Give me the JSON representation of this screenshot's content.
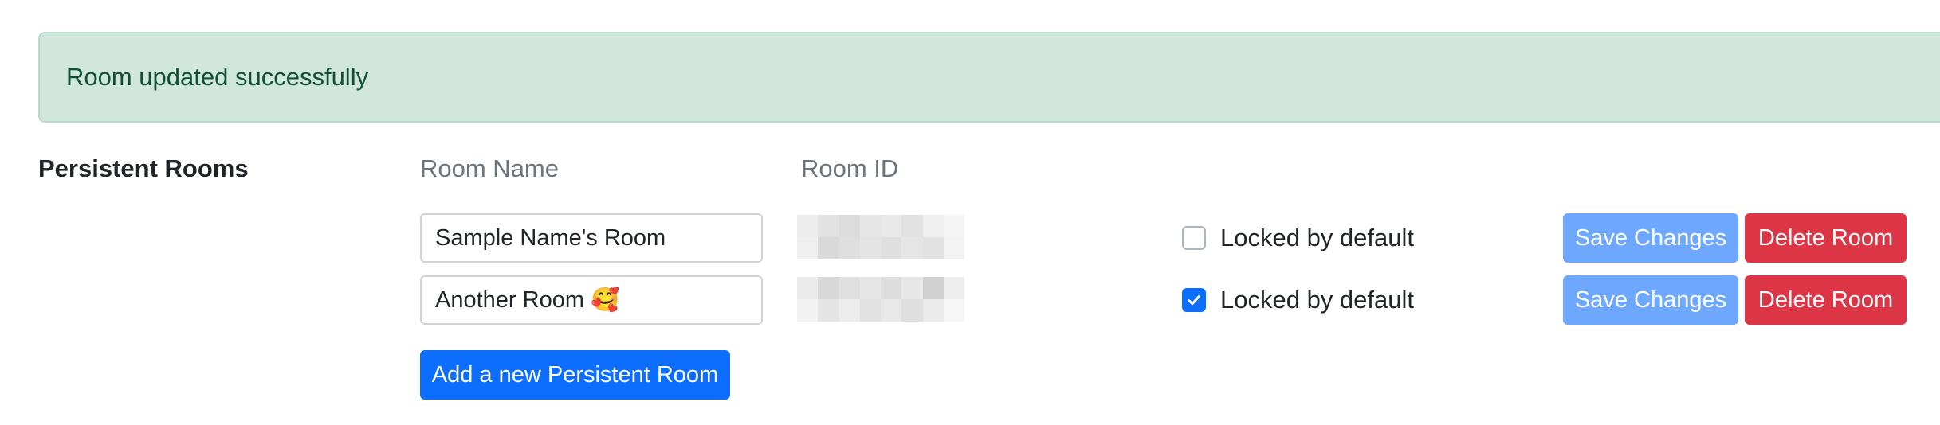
{
  "alert": {
    "message": "Room updated successfully",
    "color": "#0f5132",
    "background": "#d1e7dd"
  },
  "section": {
    "title": "Persistent Rooms"
  },
  "table": {
    "headers": {
      "room_name": "Room Name",
      "room_id": "Room ID"
    },
    "rows": [
      {
        "room_name": "Sample Name's Room",
        "room_id_display": "pixelated",
        "locked_label": "Locked by default",
        "locked": false,
        "save_label": "Save Changes",
        "delete_label": "Delete Room"
      },
      {
        "room_name": "Another Room 🥰",
        "room_id_display": "pixelated",
        "locked_label": "Locked by default",
        "locked": true,
        "save_label": "Save Changes",
        "delete_label": "Delete Room"
      }
    ]
  },
  "actions": {
    "add_label": "Add a new Persistent Room"
  },
  "colors": {
    "primary": "#0d6efd",
    "primary_disabled": "#6ea8fe",
    "danger": "#dc3545",
    "muted": "#6c757d"
  }
}
